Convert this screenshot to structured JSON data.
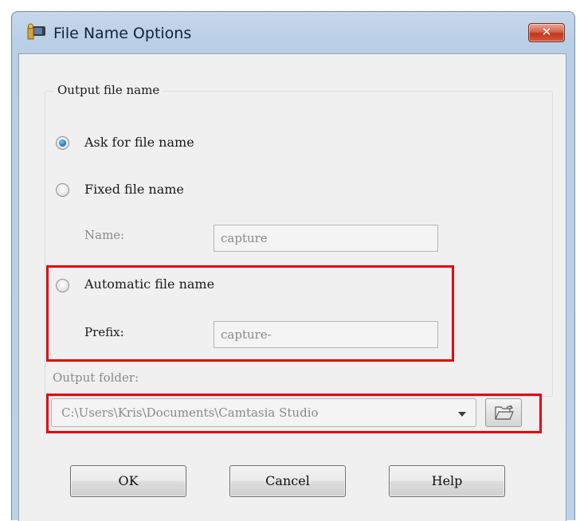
{
  "window": {
    "title": "File Name Options",
    "close_glyph": "✕"
  },
  "group": {
    "label": "Output file name"
  },
  "options": {
    "ask": {
      "label": "Ask for file name",
      "checked": true
    },
    "fixed": {
      "label": "Fixed file name",
      "checked": false
    },
    "automatic": {
      "label": "Automatic file name",
      "checked": false
    }
  },
  "fields": {
    "name_label": "Name:",
    "name_value": "capture",
    "prefix_label": "Prefix:",
    "prefix_value": "capture-"
  },
  "output_folder": {
    "label": "Output folder:",
    "value": "C:\\Users\\Kris\\Documents\\Camtasia Studio"
  },
  "buttons": {
    "ok": "OK",
    "cancel": "Cancel",
    "help": "Help"
  },
  "colors": {
    "highlight": "#e8000b",
    "radio_selected": "#2a7fc6"
  }
}
